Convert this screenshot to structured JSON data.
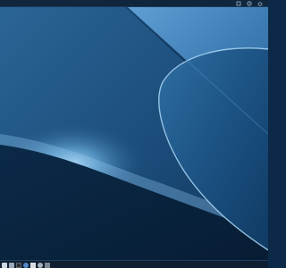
{
  "desktop": {
    "wallpaper": {
      "description_color_base": "#0c2a48",
      "accent_light": "#9fd0f2",
      "accent_mid": "#3b79ad",
      "accent_dark": "#0a2340"
    }
  },
  "top_panel": {
    "background": "#10263d",
    "tray_icons": [
      {
        "name": "system-menu-icon"
      },
      {
        "name": "clock-icon"
      },
      {
        "name": "power-icon"
      }
    ]
  },
  "bottom_panel": {
    "background": "#0d1f31",
    "launchers": [
      {
        "name": "start-menu-icon",
        "color": "#cfd9e3"
      },
      {
        "name": "file-manager-icon",
        "color": "#9aa9b8"
      },
      {
        "name": "terminal-icon",
        "color": "#2b2f35"
      },
      {
        "name": "web-browser-icon",
        "color": "#4f86c6"
      },
      {
        "name": "text-editor-icon",
        "color": "#d8dde2"
      },
      {
        "name": "settings-icon",
        "color": "#a8b2bd"
      },
      {
        "name": "trash-icon",
        "color": "#7d8792"
      }
    ]
  }
}
